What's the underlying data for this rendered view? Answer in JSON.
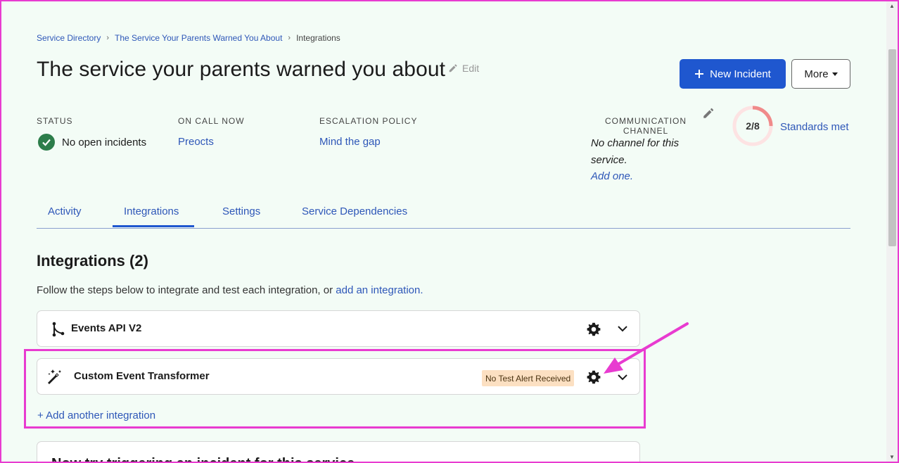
{
  "breadcrumb": {
    "items": [
      "Service Directory",
      "The Service Your Parents Warned You About",
      "Integrations"
    ],
    "separator": "›"
  },
  "page": {
    "title": "The service your parents warned you about",
    "edit_label": "Edit"
  },
  "actions": {
    "new_incident": "New Incident",
    "more": "More"
  },
  "overview": {
    "status_label": "STATUS",
    "status_value": "No open incidents",
    "oncall_label": "ON CALL NOW",
    "oncall_value": "Preocts",
    "escalation_label": "ESCALATION POLICY",
    "escalation_value": "Mind the gap",
    "comm_label": "COMMUNICATION CHANNEL",
    "comm_text": "No channel for this service.",
    "comm_add": "Add one.",
    "score": "2/8",
    "score_fraction": 0.25,
    "standards": "Standards met"
  },
  "tabs": [
    "Activity",
    "Integrations",
    "Settings",
    "Service Dependencies"
  ],
  "active_tab": "Integrations",
  "integrations": {
    "title": "Integrations (2)",
    "desc_prefix": "Follow the steps below to integrate and test each integration, or ",
    "desc_link": "add an integration.",
    "items": [
      {
        "name": "Events API V2",
        "icon": "branch-icon"
      },
      {
        "name": "Custom Event Transformer",
        "icon": "magic-wand-icon",
        "badge": "No Test Alert Received"
      }
    ],
    "add_another": "+ Add another integration"
  },
  "bottom_card": {
    "text": "Now try triggering an incident for this service"
  },
  "colors": {
    "primary": "#1f57cf",
    "link": "#2e57b8",
    "success": "#2c7d4a",
    "highlight": "#e83bd0",
    "badge_bg": "#fce0c2",
    "score_ring": "#f08a8a"
  }
}
